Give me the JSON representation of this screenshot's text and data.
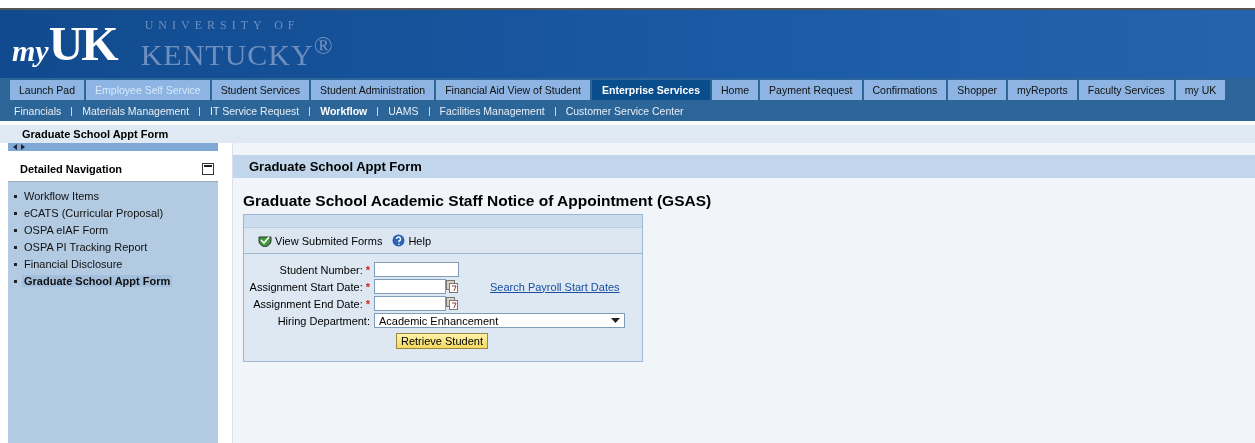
{
  "header": {
    "logo_my": "my",
    "logo_uk": "UK",
    "university_line": "UNIVERSITY OF",
    "university_name": "KENTUCKY$^{®}$"
  },
  "tabs": [
    {
      "label": "Launch Pad",
      "selected": false,
      "disabled": false
    },
    {
      "label": "Employee Self Service",
      "selected": false,
      "disabled": true
    },
    {
      "label": "Student Services",
      "selected": false,
      "disabled": false
    },
    {
      "label": "Student Administration",
      "selected": false,
      "disabled": false
    },
    {
      "label": "Financial Aid View of Student",
      "selected": false,
      "disabled": false
    },
    {
      "label": "Enterprise Services",
      "selected": true,
      "disabled": false
    },
    {
      "label": "Home",
      "selected": false,
      "disabled": false
    },
    {
      "label": "Payment Request",
      "selected": false,
      "disabled": false
    },
    {
      "label": "Confirmations",
      "selected": false,
      "disabled": false
    },
    {
      "label": "Shopper",
      "selected": false,
      "disabled": false
    },
    {
      "label": "myReports",
      "selected": false,
      "disabled": false
    },
    {
      "label": "Faculty Services",
      "selected": false,
      "disabled": false
    },
    {
      "label": "my UK",
      "selected": false,
      "disabled": false
    }
  ],
  "subtabs": [
    {
      "label": "Financials",
      "selected": false
    },
    {
      "label": "Materials Management",
      "selected": false
    },
    {
      "label": "IT Service Request",
      "selected": false
    },
    {
      "label": "Workflow",
      "selected": true
    },
    {
      "label": "UAMS",
      "selected": false
    },
    {
      "label": "Facilities Management",
      "selected": false
    },
    {
      "label": "Customer Service Center",
      "selected": false
    }
  ],
  "page_title": "Graduate School Appt Form",
  "sidebar": {
    "title": "Detailed Navigation",
    "items": [
      {
        "label": "Workflow Items",
        "selected": false
      },
      {
        "label": "eCATS (Curricular Proposal)",
        "selected": false
      },
      {
        "label": "OSPA eIAF Form",
        "selected": false
      },
      {
        "label": "OSPA PI Tracking Report",
        "selected": false
      },
      {
        "label": "Financial Disclosure",
        "selected": false
      },
      {
        "label": "Graduate School Appt Form",
        "selected": true
      }
    ]
  },
  "content": {
    "title": "Graduate School Appt Form",
    "heading": "Graduate School Academic Staff Notice of Appointment (GSAS)",
    "toolbar": [
      {
        "kind": "check",
        "label": "View Submited Forms"
      },
      {
        "kind": "help",
        "label": "Help"
      }
    ],
    "fields": [
      {
        "kind": "text",
        "label": "Student Number:",
        "required": true
      },
      {
        "kind": "date",
        "label": "Assignment Start Date:",
        "required": true,
        "link": "Search Payroll Start Dates"
      },
      {
        "kind": "date",
        "label": "Assignment End Date:",
        "required": true
      },
      {
        "kind": "select",
        "label": "Hiring Department:",
        "required": false,
        "value": "Academic Enhancement"
      }
    ],
    "required_mark": "*",
    "button": "Retrieve Student"
  }
}
